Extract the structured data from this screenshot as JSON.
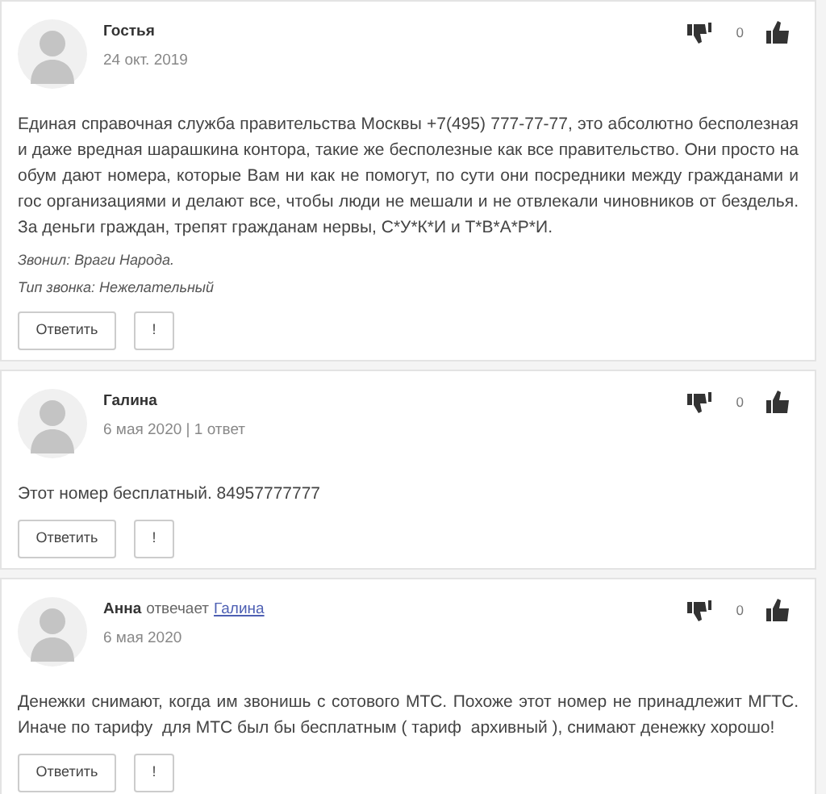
{
  "comments": [
    {
      "author": "Гостья",
      "date": "24 окт. 2019",
      "dislike_label": "0",
      "text": "Единая справочная служба правительства Москвы +7(495) 777-77-77, это абсолютно бесполезная и даже вредная шарашкина контора, такие же бесполезные как все правительство. Они просто на обум дают номера, которые Вам ни как не помогут, по сути они посредники между гражданами и гос организациями и делают все, чтобы люди не мешали и не отвлекали чиновников от безделья. За деньги граждан, трепят гражданам нервы, С*У*К*И и Т*В*А*Р*И.",
      "notes": [
        "Звонил: Враги Народа.",
        "Тип звонка: Нежелательный"
      ],
      "buttons": [
        "Ответить",
        "!"
      ]
    },
    {
      "author": "Галина",
      "date": "6 мая 2020 | 1 ответ",
      "dislike_label": "0",
      "text": "Этот номер бесплатный. 84957777777",
      "buttons": [
        "Ответить",
        "!"
      ]
    },
    {
      "author": "Анна",
      "reply_verb": "отвечает",
      "reply_to": "Галина",
      "date": "6 мая 2020",
      "dislike_label": "0",
      "text": "Денежки снимают, когда им звонишь с сотового МТС. Похоже этот номер не принадлежит МГТС. Иначе по тарифу  для МТС был бы бесплатным ( тариф  архивный ), снимают денежку хорошо!",
      "buttons": [
        "Ответить",
        "!"
      ]
    }
  ]
}
